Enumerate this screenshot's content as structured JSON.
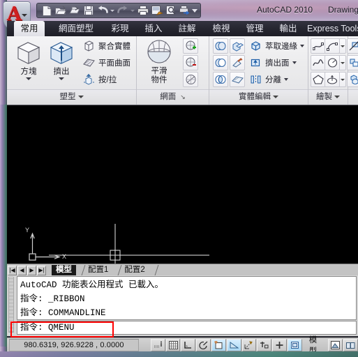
{
  "window": {
    "app_title": "AutoCAD 2010",
    "document_title": "Drawing",
    "app_button_glyph": "A"
  },
  "quick_access": {
    "items": [
      {
        "name": "new-file-icon",
        "tip": "新建"
      },
      {
        "name": "open-file-icon",
        "tip": "開啟"
      },
      {
        "name": "save-as-icon",
        "tip": "另存"
      },
      {
        "name": "save-icon",
        "tip": "儲存"
      },
      {
        "name": "undo-icon",
        "tip": "復原"
      },
      {
        "name": "redo-icon",
        "tip": "重做"
      },
      {
        "name": "plot-icon",
        "tip": "出圖"
      },
      {
        "name": "plot-preview-icon",
        "tip": "出圖預覽"
      },
      {
        "name": "preview-icon",
        "tip": "預覽"
      },
      {
        "name": "publish-icon",
        "tip": "發佈"
      },
      {
        "name": "qat-overflow-icon",
        "tip": "更多"
      }
    ]
  },
  "ribbon": {
    "tabs": [
      {
        "label": "常用",
        "active": true
      },
      {
        "label": "網面塑型",
        "active": false
      },
      {
        "label": "彩現",
        "active": false
      },
      {
        "label": "插入",
        "active": false
      },
      {
        "label": "註解",
        "active": false
      },
      {
        "label": "檢視",
        "active": false
      },
      {
        "label": "管理",
        "active": false
      },
      {
        "label": "輸出",
        "active": false
      },
      {
        "label": "Express Tools",
        "active": false
      }
    ],
    "panels": [
      {
        "title": "塑型",
        "expander": "caret",
        "big_buttons": [
          {
            "label": "方塊",
            "icon": "box-solid-icon",
            "has_dropdown": true
          },
          {
            "label": "擠出",
            "icon": "extrude-solid-icon",
            "has_dropdown": true
          }
        ],
        "row_buttons": [
          {
            "label": "聚合實體",
            "icon": "polysolid-icon",
            "has_dropdown": false
          },
          {
            "label": "平面曲面",
            "icon": "planar-surface-icon",
            "has_dropdown": false
          },
          {
            "label": "按/拉",
            "icon": "presspull-icon",
            "has_dropdown": false
          }
        ]
      },
      {
        "title": "網面",
        "expander": "dialog-launcher",
        "big_buttons": [
          {
            "label_line1": "平滑",
            "label_line2": "物件",
            "icon": "smooth-object-icon"
          }
        ],
        "grid_buttons": [
          {
            "icon": "smooth-more-icon"
          },
          {
            "icon": "smooth-less-icon"
          },
          {
            "icon": "refine-mesh-icon"
          }
        ]
      },
      {
        "title": "實體編輯",
        "expander": "caret",
        "grid_buttons": [
          {
            "icon": "union-icon"
          },
          {
            "icon": "subtract-icon"
          },
          {
            "icon": "intersect-icon"
          },
          {
            "icon": "solid-edit-icon"
          },
          {
            "icon": "taper-face-icon"
          },
          {
            "icon": "clean-icon"
          }
        ],
        "row_buttons": [
          {
            "label": "萃取邊緣",
            "icon": "extract-edges-icon",
            "has_dropdown": true
          },
          {
            "label": "擠出面",
            "icon": "extrude-face-icon",
            "has_dropdown": true
          },
          {
            "label": "分離",
            "icon": "separate-icon",
            "has_dropdown": true
          }
        ]
      },
      {
        "title": "繪製",
        "expander": "caret",
        "grid_buttons": [
          {
            "icon": "polyline-icon"
          },
          {
            "icon": "revcloud-icon"
          },
          {
            "icon": "arc-icon",
            "has_dropdown": true
          },
          {
            "icon": "spline-icon"
          },
          {
            "icon": "line-icon"
          },
          {
            "icon": "circle-icon",
            "has_dropdown": true
          },
          {
            "icon": "polygon-icon"
          },
          {
            "icon": "rectangle-icon"
          },
          {
            "icon": "ellipse-icon",
            "has_dropdown": true
          }
        ]
      },
      {
        "title": "",
        "expander": "none",
        "grid_buttons": [
          {
            "icon": "section-plane-icon"
          },
          {
            "icon": "slice-icon"
          },
          {
            "icon": "4-view-icon"
          }
        ]
      }
    ]
  },
  "canvas": {
    "ucs_x_label": "X",
    "ucs_y_label": "Y",
    "background_color": "#000000"
  },
  "layout_tabs": {
    "nav_buttons": [
      "first-layout-icon",
      "prev-layout-icon",
      "next-layout-icon",
      "last-layout-icon"
    ],
    "tabs": [
      {
        "label": "模型",
        "active": true
      },
      {
        "label": "配置1",
        "active": false
      },
      {
        "label": "配置2",
        "active": false
      }
    ]
  },
  "command_window": {
    "history": [
      "AutoCAD 功能表公用程式 已載入。",
      "指令: _RIBBON",
      "指令: COMMANDLINE"
    ],
    "prompt": "指令: ",
    "current_input": "QMENU",
    "highlight_color": "#ff0000"
  },
  "status_bar": {
    "coordinates": "980.6319, 926.9228 , 0.0000",
    "toggles": [
      {
        "name": "infer-constraints-icon",
        "active": false
      },
      {
        "name": "grid-display-icon",
        "active": false
      },
      {
        "name": "snap-mode-icon",
        "active": false
      },
      {
        "name": "ortho-mode-icon",
        "active": false
      },
      {
        "name": "polar-tracking-icon",
        "active": true
      },
      {
        "name": "object-snap-icon",
        "active": true
      },
      {
        "name": "osnap-tracking-icon",
        "active": false
      },
      {
        "name": "allow-ucs-icon",
        "active": false
      },
      {
        "name": "dynamic-ucs-icon",
        "active": false
      },
      {
        "name": "dynamic-input-icon",
        "active": true
      }
    ],
    "space_label": "模型",
    "view_buttons": [
      {
        "name": "quick-view-layouts-icon"
      },
      {
        "name": "quick-view-drawings-icon"
      }
    ]
  }
}
